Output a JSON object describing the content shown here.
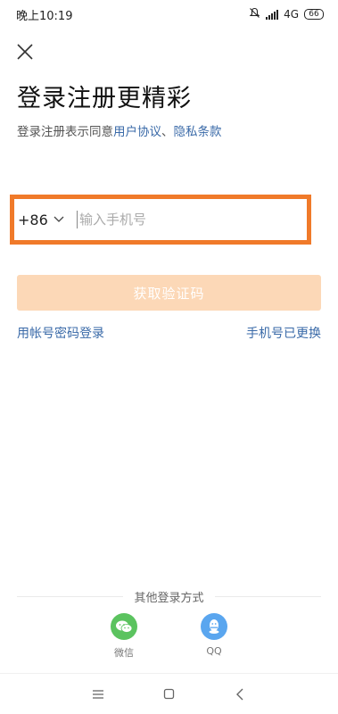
{
  "status_bar": {
    "time": "晚上10:19",
    "network": "4G",
    "battery": "66"
  },
  "icons": {
    "close": "close-icon",
    "dropdown": "chevron-down-icon",
    "wechat": "wechat-icon",
    "qq": "qq-icon",
    "menu": "menu-icon",
    "home": "home-icon",
    "back": "back-icon",
    "mute": "bell-off-icon",
    "signal": "signal-icon",
    "battery": "battery-icon"
  },
  "header": {
    "title": "登录注册更精彩",
    "agreement_prefix": "登录注册表示同意",
    "user_agreement": "用户协议",
    "separator": "、",
    "privacy_policy": "隐私条款"
  },
  "phone_form": {
    "country_code": "+86",
    "placeholder": "输入手机号",
    "value": ""
  },
  "buttons": {
    "get_code": "获取验证码",
    "account_login": "用帐号密码登录",
    "phone_changed": "手机号已更换"
  },
  "other_login": {
    "title": "其他登录方式",
    "wechat_label": "微信",
    "qq_label": "QQ"
  },
  "colors": {
    "accent_orange": "#f07a2a",
    "button_disabled": "#fcd8b7",
    "link_blue": "#3a6aa8",
    "wechat_green": "#5bc35f",
    "qq_blue": "#5aa6ef"
  }
}
